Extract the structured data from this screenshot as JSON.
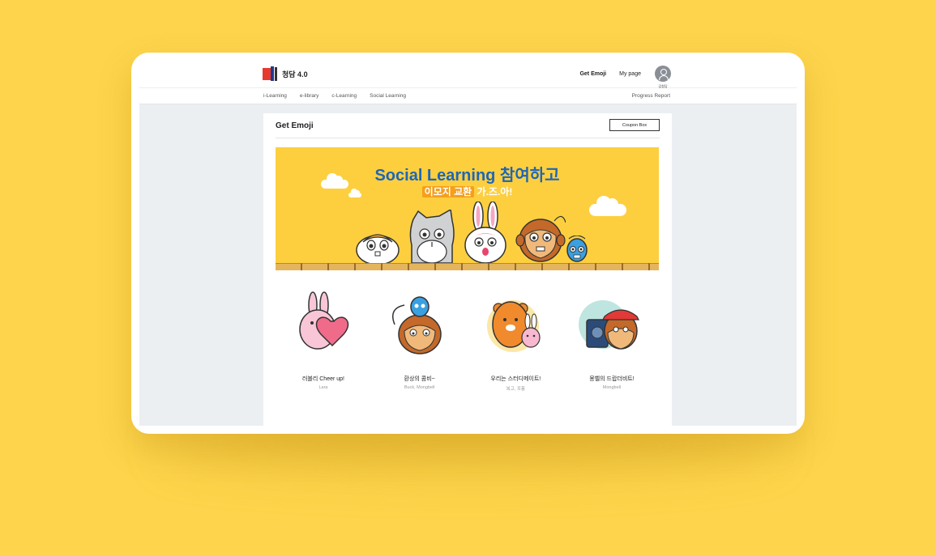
{
  "header": {
    "logo_text": "청담 4.0",
    "nav": [
      {
        "label": "Get Emoji",
        "active": true
      },
      {
        "label": "My page",
        "active": false
      }
    ],
    "user_name": "김청담"
  },
  "subnav": {
    "items": [
      "i-Learning",
      "e-library",
      "c-Learning",
      "Social Learning"
    ],
    "right": "Progress Report"
  },
  "panel": {
    "title": "Get Emoji",
    "coupon_button": "Coupon Box"
  },
  "banner": {
    "title": "Social Learning 참여하고",
    "subtitle_highlight": "이모지 교환",
    "subtitle_rest": " 가.즈.아!"
  },
  "cards": [
    {
      "title": "러블리 Cheer up!",
      "characters": "Lara",
      "icon": "bunny-heart-icon"
    },
    {
      "title": "환상의 콤비~",
      "characters": "Buck, Mongbell",
      "icon": "monkey-robot-icon"
    },
    {
      "title": "우리는 스터디메이트!",
      "characters": "복고, 포퐁",
      "icon": "tiger-bunny-icon"
    },
    {
      "title": "몽벨의 드랍더비트!",
      "characters": "Mongbell",
      "icon": "monkey-dj-icon"
    }
  ],
  "colors": {
    "background": "#fdd44b",
    "banner": "#fdcf3f",
    "banner_title": "#1e66b6",
    "highlight": "#f59f1b",
    "logo_red": "#e8392e",
    "logo_blue": "#1f3a93"
  }
}
